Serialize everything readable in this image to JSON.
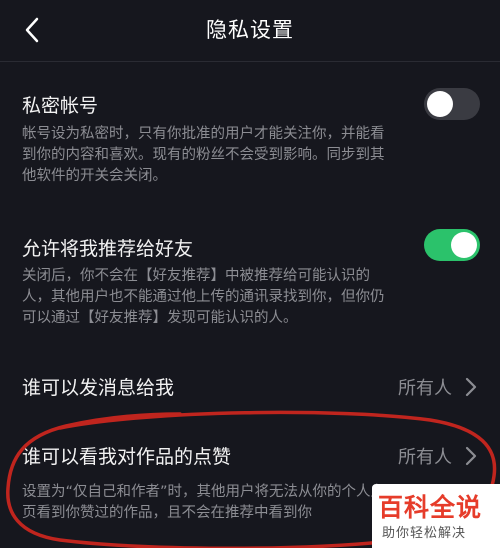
{
  "header": {
    "title": "隐私设置",
    "back_icon": "chevron-left-icon"
  },
  "private_account": {
    "title": "私密帐号",
    "desc_lines": [
      "帐号设为私密时，只有你批准的用户才能关注你，并能看",
      "到你的内容和喜欢。现有的粉丝不会受到影响。同步到其",
      "他软件的开关会关闭。"
    ],
    "toggle_on": false
  },
  "recommend_friends": {
    "title": "允许将我推荐给好友",
    "desc_lines": [
      "关闭后，你不会在【好友推荐】中被推荐给可能认识的",
      "人，其他用户也不能通过他上传的通讯录找到你，但你仍",
      "可以通过【好友推荐】发现可能认识的人。"
    ],
    "toggle_on": true
  },
  "message_setting": {
    "label": "谁可以发消息给我",
    "value": "所有人",
    "icon": "chevron-right-icon"
  },
  "likes_setting": {
    "label": "谁可以看我对作品的点赞",
    "value": "所有人",
    "icon": "chevron-right-icon",
    "desc_lines": [
      "设置为“仅自己和作者”时，其他用户将无法从你的个人主",
      "页看到你赞过的作品，且不会在推荐中看到你"
    ]
  },
  "watermark": {
    "main": "百科全说",
    "sub": "助你轻松解决"
  },
  "colors": {
    "background": "#16171e",
    "toggle_on": "#2bc26b",
    "annotation_circle": "#c0251e"
  }
}
